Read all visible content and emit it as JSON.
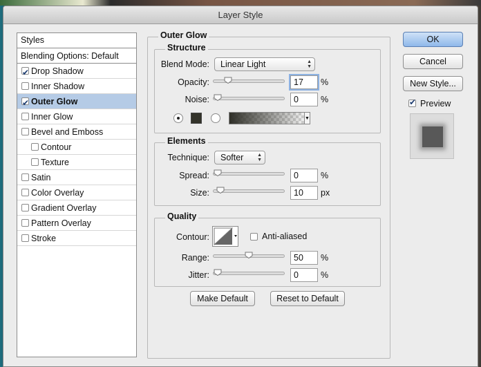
{
  "window": {
    "title": "Layer Style"
  },
  "styles_panel": {
    "header": "Styles",
    "blending": "Blending Options: Default",
    "items": [
      {
        "label": "Drop Shadow",
        "checked": true,
        "selected": false,
        "sub": false
      },
      {
        "label": "Inner Shadow",
        "checked": false,
        "selected": false,
        "sub": false
      },
      {
        "label": "Outer Glow",
        "checked": true,
        "selected": true,
        "sub": false
      },
      {
        "label": "Inner Glow",
        "checked": false,
        "selected": false,
        "sub": false
      },
      {
        "label": "Bevel and Emboss",
        "checked": false,
        "selected": false,
        "sub": false
      },
      {
        "label": "Contour",
        "checked": false,
        "selected": false,
        "sub": true
      },
      {
        "label": "Texture",
        "checked": false,
        "selected": false,
        "sub": true
      },
      {
        "label": "Satin",
        "checked": false,
        "selected": false,
        "sub": false
      },
      {
        "label": "Color Overlay",
        "checked": false,
        "selected": false,
        "sub": false
      },
      {
        "label": "Gradient Overlay",
        "checked": false,
        "selected": false,
        "sub": false
      },
      {
        "label": "Pattern Overlay",
        "checked": false,
        "selected": false,
        "sub": false
      },
      {
        "label": "Stroke",
        "checked": false,
        "selected": false,
        "sub": false
      }
    ]
  },
  "outer_glow": {
    "title": "Outer Glow",
    "structure": {
      "title": "Structure",
      "blend_mode_label": "Blend Mode:",
      "blend_mode_value": "Linear Light",
      "opacity_label": "Opacity:",
      "opacity_value": "17",
      "opacity_unit": "%",
      "opacity_level": 0.17,
      "noise_label": "Noise:",
      "noise_value": "0",
      "noise_unit": "%",
      "noise_level": 0,
      "glow_color": "#33332a"
    },
    "elements": {
      "title": "Elements",
      "technique_label": "Technique:",
      "technique_value": "Softer",
      "spread_label": "Spread:",
      "spread_value": "0",
      "spread_unit": "%",
      "spread_level": 0,
      "size_label": "Size:",
      "size_value": "10",
      "size_unit": "px",
      "size_level": 0.04
    },
    "quality": {
      "title": "Quality",
      "contour_label": "Contour:",
      "antialiased_label": "Anti-aliased",
      "antialiased_checked": false,
      "range_label": "Range:",
      "range_value": "50",
      "range_unit": "%",
      "range_level": 0.5,
      "jitter_label": "Jitter:",
      "jitter_value": "0",
      "jitter_unit": "%",
      "jitter_level": 0
    },
    "make_default": "Make Default",
    "reset_default": "Reset to Default"
  },
  "actions": {
    "ok": "OK",
    "cancel": "Cancel",
    "new_style": "New Style...",
    "preview_label": "Preview",
    "preview_checked": true
  }
}
